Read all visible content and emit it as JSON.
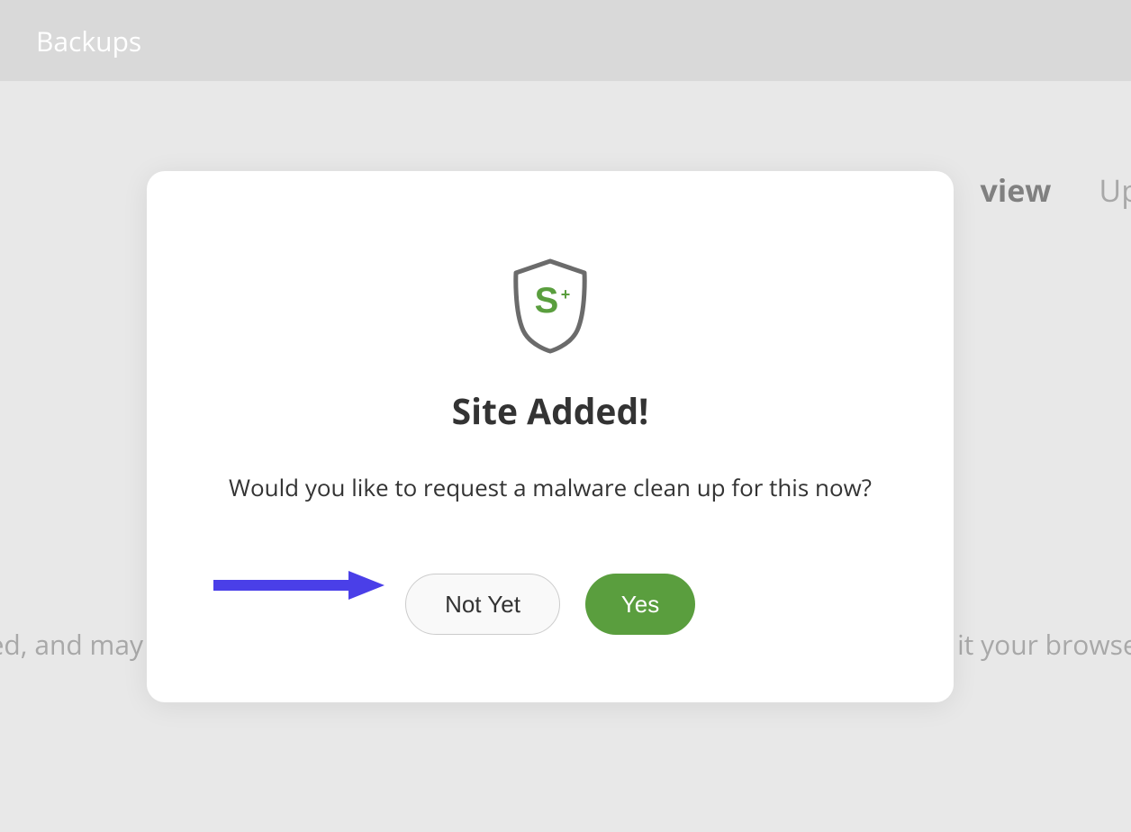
{
  "header": {
    "title": "Backups"
  },
  "background": {
    "tab_text_bold": "view",
    "tab_text_right": "Up",
    "bottom_text_left": "led, and may",
    "bottom_text_right": "it your browser"
  },
  "modal": {
    "title": "Site Added!",
    "subtitle": "Would you like to request a malware clean up for this now?",
    "not_yet_label": "Not Yet",
    "yes_label": "Yes",
    "icon_letter": "S",
    "icon_plus": "+"
  }
}
